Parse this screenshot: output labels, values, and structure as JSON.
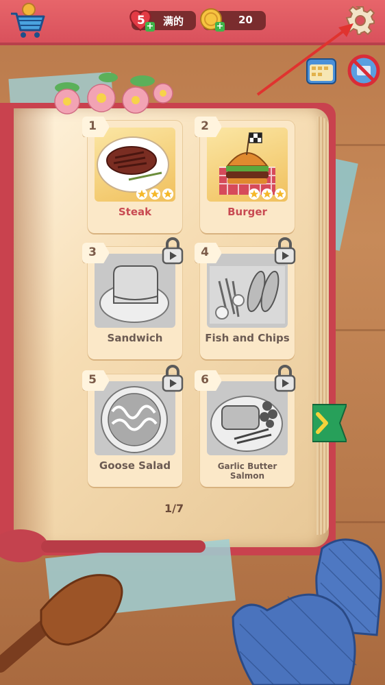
{
  "topbar": {
    "hearts_count": "5",
    "hearts_status": "满的",
    "coins_count": "20"
  },
  "icons": {
    "cart": "shopping-cart-icon",
    "heart": "heart-icon",
    "coin": "coin-icon",
    "settings": "gear-icon",
    "calendar": "calendar-icon",
    "no_ads": "no-ads-icon",
    "lock": "lock-video-icon",
    "next": "chevron-right-icon"
  },
  "recipes": [
    {
      "number": "1",
      "name": "Steak",
      "locked": false,
      "stars": 3
    },
    {
      "number": "2",
      "name": "Burger",
      "locked": false,
      "stars": 3
    },
    {
      "number": "3",
      "name": "Sandwich",
      "locked": true
    },
    {
      "number": "4",
      "name": "Fish and Chips",
      "locked": true
    },
    {
      "number": "5",
      "name": "Goose Salad",
      "locked": true
    },
    {
      "number": "6",
      "name": "Garlic Butter Salmon",
      "locked": true
    }
  ],
  "pagination": {
    "label": "1/7"
  },
  "colors": {
    "topbar": "#d9515c",
    "accent_green": "#3fb54a",
    "arrow_red": "#e0332f"
  }
}
